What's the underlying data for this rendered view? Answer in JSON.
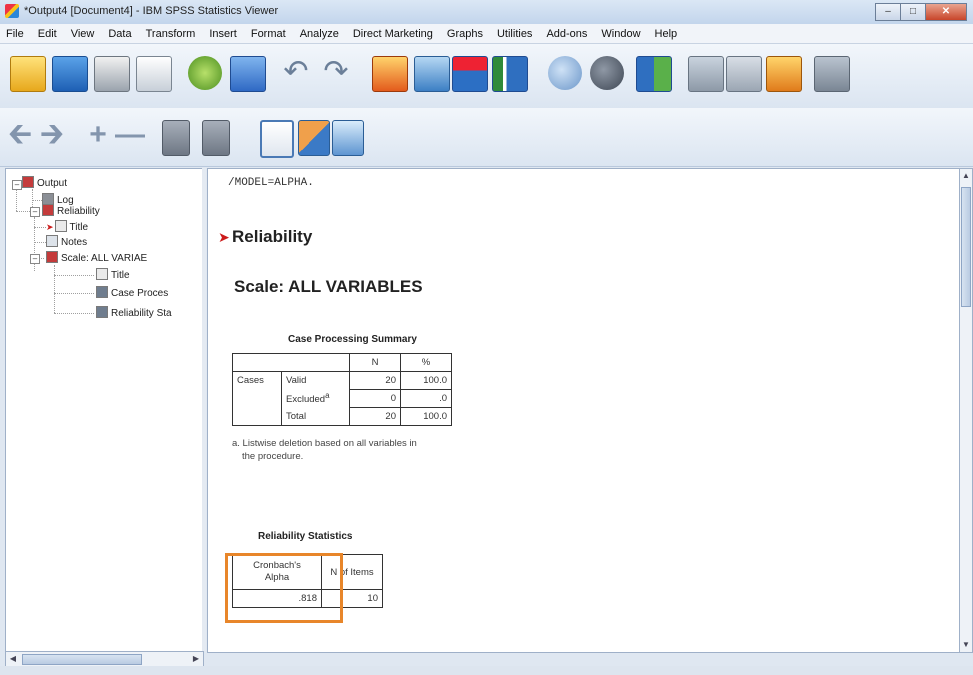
{
  "window": {
    "title": "*Output4 [Document4] - IBM SPSS Statistics Viewer"
  },
  "menu": [
    "File",
    "Edit",
    "View",
    "Data",
    "Transform",
    "Insert",
    "Format",
    "Analyze",
    "Direct Marketing",
    "Graphs",
    "Utilities",
    "Add-ons",
    "Window",
    "Help"
  ],
  "toolbar1": [
    "open-icon",
    "save-icon",
    "print-icon",
    "print-preview-icon",
    "export-icon",
    "dialog-recall-icon",
    "undo-icon",
    "redo-icon",
    "goto-case-icon",
    "goto-variable-icon",
    "chart-builder-icon",
    "variables-icon",
    "select-cases-icon",
    "weight-cases-icon",
    "split-file-icon",
    "script-icon",
    "value-labels-icon",
    "use-sets-icon",
    "designate-window-icon"
  ],
  "toolbar2": [
    "promote-icon",
    "demote-icon",
    "expand-icon",
    "collapse-icon",
    "show-icon",
    "hide-icon",
    "insert-heading-icon",
    "insert-title-icon",
    "insert-text-icon"
  ],
  "tree": {
    "output": "Output",
    "log": "Log",
    "reliability": "Reliability",
    "title": "Title",
    "notes": "Notes",
    "scale": "Scale: ALL VARIAE",
    "scale_title": "Title",
    "case_proc": "Case Proces",
    "rel_stats": "Reliability Sta"
  },
  "content": {
    "syntax": "/MODEL=ALPHA.",
    "heading": "Reliability",
    "scale_heading": "Scale: ALL VARIABLES",
    "cps": {
      "caption": "Case Processing Summary",
      "col_n": "N",
      "col_pct": "%",
      "group": "Cases",
      "rows": [
        {
          "label": "Valid",
          "n": "20",
          "pct": "100.0"
        },
        {
          "label": "Excluded",
          "sup": "a",
          "n": "0",
          "pct": ".0"
        },
        {
          "label": "Total",
          "n": "20",
          "pct": "100.0"
        }
      ],
      "footnote_line1": "a. Listwise deletion based on all variables in",
      "footnote_line2": "the procedure."
    },
    "rs": {
      "caption": "Reliability Statistics",
      "col_alpha_1": "Cronbach's",
      "col_alpha_2": "Alpha",
      "col_items": "N of Items",
      "alpha": ".818",
      "items": "10"
    }
  },
  "colors": {
    "highlight": "#e8862a",
    "accent_arrow": "#cc1b1b"
  }
}
